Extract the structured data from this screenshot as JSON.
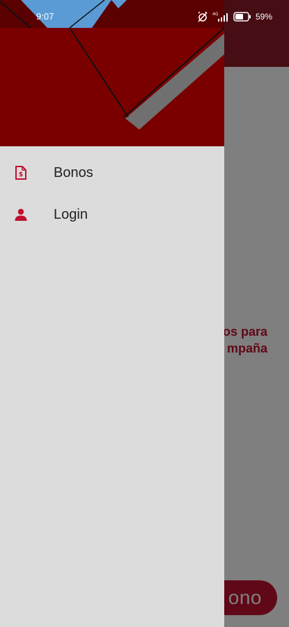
{
  "status_bar": {
    "time": "9:07",
    "battery_percent": "59%",
    "network_label": "4G"
  },
  "background_app": {
    "text_line1": "os para",
    "text_line2": "mpaña",
    "fab_label": "ono"
  },
  "drawer": {
    "items": [
      {
        "label": "Bonos",
        "icon": "document-dollar-icon"
      },
      {
        "label": "Login",
        "icon": "person-icon"
      }
    ]
  },
  "colors": {
    "accent": "#c0102e",
    "drawer_background": "#dcdcdc",
    "header_dark_red": "#7a0000",
    "header_blue": "#5b9bd5",
    "header_gray": "#707070"
  }
}
